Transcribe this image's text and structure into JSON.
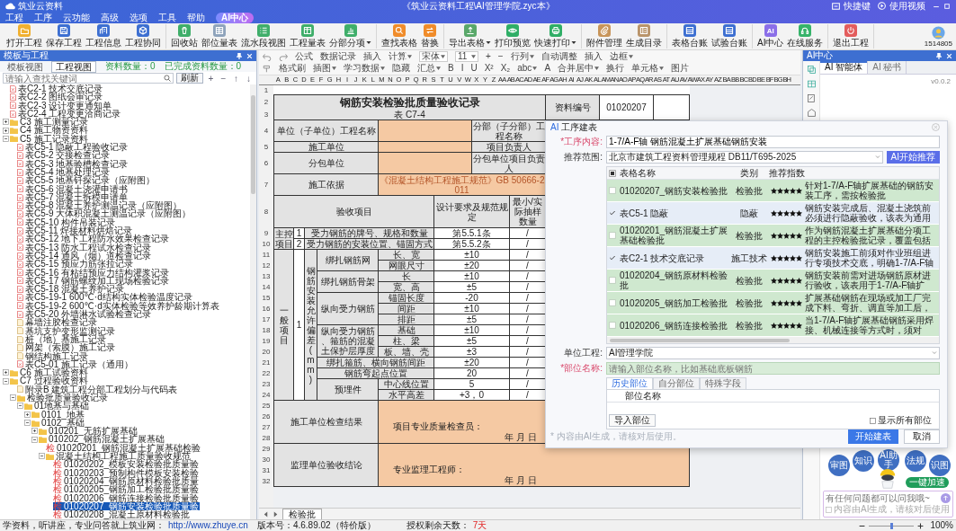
{
  "window": {
    "app_name": "筑业云资料",
    "title": "《筑业云资料工程\\AI管理学院.zyc本》",
    "links": [
      "快捷键",
      "使用视频"
    ]
  },
  "menu": [
    {
      "label": "工程",
      "kind": "item"
    },
    {
      "label": "工序",
      "kind": "item"
    },
    {
      "label": "云功能",
      "kind": "item"
    },
    {
      "label": "高级",
      "kind": "item"
    },
    {
      "label": "选项",
      "kind": "item"
    },
    {
      "label": "工具",
      "kind": "item"
    },
    {
      "label": "帮助",
      "kind": "item"
    },
    {
      "label": "AI中心",
      "kind": "pill"
    }
  ],
  "toolbar": {
    "groups": [
      [
        {
          "label": "打开工程",
          "has_menu": false
        },
        {
          "label": "保存工程",
          "has_menu": false
        },
        {
          "label": "工程信息",
          "has_menu": false
        },
        {
          "label": "工程协同",
          "has_menu": false
        }
      ],
      [
        {
          "label": "回收站",
          "has_menu": false
        },
        {
          "label": "部位量表",
          "has_menu": false
        },
        {
          "label": "流水段视图",
          "has_menu": false
        },
        {
          "label": "工程量表",
          "has_menu": false
        },
        {
          "label": "分部分项",
          "has_menu": true
        }
      ],
      [
        {
          "label": "查找表格",
          "has_menu": false
        },
        {
          "label": "替换",
          "has_menu": false
        }
      ],
      [
        {
          "label": "导出表格",
          "has_menu": true
        },
        {
          "label": "打印预览",
          "has_menu": false
        },
        {
          "label": "快速打印",
          "has_menu": true
        }
      ],
      [
        {
          "label": "附件管理",
          "has_menu": false
        },
        {
          "label": "生成目录",
          "has_menu": false
        }
      ],
      [
        {
          "label": "表格台账",
          "has_menu": false
        },
        {
          "label": "试验台账",
          "has_menu": false
        }
      ],
      [
        {
          "label": "AI中心",
          "glyph": "AI",
          "has_menu": false
        },
        {
          "label": "在线服务",
          "has_menu": false
        }
      ],
      [
        {
          "label": "退出工程",
          "has_menu": false
        }
      ]
    ],
    "user": "1514805"
  },
  "tree_panel": {
    "title": "模板与工程",
    "tabs": [
      {
        "label": "模板视图",
        "selected": false
      },
      {
        "label": "工程视图",
        "selected": true
      }
    ],
    "count": "资料数量：0",
    "done_count": "已完成资料数量：0",
    "search": {
      "placeholder": "请输入查找关键词"
    },
    "search_button": "刷新",
    "actions": [
      "+",
      "−",
      "↑",
      "↓"
    ]
  },
  "tree": {
    "items": [
      {
        "label": "表C2-1 技术交底记录",
        "kind": "form",
        "selected": false
      },
      {
        "label": "表C2-2 图纸会审记录",
        "kind": "form",
        "selected": false
      },
      {
        "label": "表C2-3 设计变更通知单",
        "kind": "form",
        "selected": false
      },
      {
        "label": "表C2-4 工程变更洽商记录",
        "kind": "form",
        "selected": false
      },
      {
        "label": "C3 施工测量记录",
        "kind": "folder",
        "expanded": false,
        "selected": false
      },
      {
        "label": "C4 施工物资资料",
        "kind": "folder",
        "expanded": false,
        "selected": false
      },
      {
        "label": "C5 施工记录资料",
        "kind": "folder",
        "expanded": true,
        "selected": false,
        "children": [
          {
            "label": "表C5-1 隐蔽工程验收记录",
            "kind": "form",
            "selected": false
          },
          {
            "label": "表C5-2 交接检查记录",
            "kind": "form",
            "selected": false
          },
          {
            "label": "表C5-3 地基验槽检查记录",
            "kind": "form",
            "selected": false
          },
          {
            "label": "表C5-4 地基处理记录",
            "kind": "form",
            "selected": false
          },
          {
            "label": "表C5-5 地基钎探记录（应附图）",
            "kind": "form",
            "selected": false
          },
          {
            "label": "表C5-6 混凝土浇灌申请书",
            "kind": "form",
            "selected": false
          },
          {
            "label": "表C5-7 混凝土拆模申请单",
            "kind": "form",
            "selected": false
          },
          {
            "label": "表C5-8 混凝土养护测温记录（应附图）",
            "kind": "form",
            "selected": false
          },
          {
            "label": "表C5-9 大体积混凝土测温记录（应附图）",
            "kind": "form",
            "selected": false
          },
          {
            "label": "表C5-10 构件吊装记录",
            "kind": "form",
            "selected": false
          },
          {
            "label": "表C5-11 焊接材料烘焙记录",
            "kind": "form",
            "selected": false
          },
          {
            "label": "表C5-12 地下工程防水效果检查记录",
            "kind": "form",
            "selected": false
          },
          {
            "label": "表C5-13 防水工程试水检查记录",
            "kind": "form",
            "selected": false
          },
          {
            "label": "表C5-14 通风（烟）道检查记录",
            "kind": "form",
            "selected": false
          },
          {
            "label": "表C5-15 预应力筋张拉记录",
            "kind": "form",
            "selected": false
          },
          {
            "label": "表C5-16 有粘结预应力结构灌浆记录",
            "kind": "form",
            "selected": false
          },
          {
            "label": "表C5-17 钢筋螺纹加工现场检验记录",
            "kind": "form",
            "selected": false
          },
          {
            "label": "表C5-18 混凝土养护记录",
            "kind": "form",
            "selected": false
          },
          {
            "label": "表C5-19-1 600℃·d结构实体检验温度记录",
            "kind": "form",
            "selected": false
          },
          {
            "label": "表C5-19-2 600℃·d实体检验等效养护龄期计算表",
            "kind": "form",
            "selected": false
          },
          {
            "label": "表C5-20 外墙淋水试验检查记录",
            "kind": "form",
            "selected": false
          },
          {
            "label": "幕墙注胶检查记录",
            "kind": "record",
            "selected": false
          },
          {
            "label": "基坑支护变形监测记录",
            "kind": "record",
            "selected": false
          },
          {
            "label": "桩（地）基施工记录",
            "kind": "record",
            "selected": false
          },
          {
            "label": "网架（索膜）施工记录",
            "kind": "record",
            "selected": false
          },
          {
            "label": "钢结构施工记录",
            "kind": "record",
            "selected": false
          },
          {
            "label": "表C5-01 施工记录（通用）",
            "kind": "form",
            "selected": false
          }
        ]
      },
      {
        "label": "C6 施工试验资料",
        "kind": "folder",
        "expanded": false,
        "selected": false
      },
      {
        "label": "C7 过程验收资料",
        "kind": "folder",
        "expanded": true,
        "selected": false,
        "children": [
          {
            "label": "附录B 建筑工程分部工程划分与代码表",
            "kind": "record",
            "selected": false
          },
          {
            "label": "检验批质量验收记录",
            "kind": "folder",
            "expanded": true,
            "selected": false,
            "children": [
              {
                "label": "01地基与基础",
                "kind": "folder",
                "expanded": true,
                "selected": false,
                "children": [
                  {
                    "label": "0101_地基",
                    "kind": "folder",
                    "expanded": false,
                    "selected": false
                  },
                  {
                    "label": "0102_基础",
                    "kind": "folder",
                    "expanded": true,
                    "selected": false,
                    "children": [
                      {
                        "label": "010201_无筋扩展基础",
                        "kind": "folder",
                        "expanded": false,
                        "selected": false
                      },
                      {
                        "label": "010202_钢筋混凝土扩展基础",
                        "kind": "folder",
                        "expanded": true,
                        "selected": false,
                        "children": [
                          {
                            "label": "01020201_钢筋混凝土扩展基础检验",
                            "kind": "batch",
                            "mark": "检",
                            "selected": false
                          },
                          {
                            "label": "混凝土结构工程施工质量验收规范",
                            "kind": "folder",
                            "expanded": true,
                            "selected": false,
                            "children": [
                              {
                                "label": "01020202_模板安装检验批质量验",
                                "kind": "batch",
                                "mark": "检",
                                "selected": false
                              },
                              {
                                "label": "01020203_预制构件模板安装检验",
                                "kind": "batch",
                                "mark": "检",
                                "selected": false
                              },
                              {
                                "label": "01020204_钢筋原材料检验批质量",
                                "kind": "batch",
                                "mark": "检",
                                "selected": false
                              },
                              {
                                "label": "01020205_钢筋加工检验批质量验",
                                "kind": "batch",
                                "mark": "检",
                                "selected": false
                              },
                              {
                                "label": "01020206_钢筋连接检验批质量验",
                                "kind": "batch",
                                "mark": "检",
                                "selected": false
                              },
                              {
                                "label": "01020207_钢筋安装检验批质量验",
                                "kind": "batch",
                                "mark": "检",
                                "selected": true
                              },
                              {
                                "label": "01020208_混凝土原材料检验批",
                                "kind": "batch",
                                "mark": "检",
                                "selected": false
                              }
                            ]
                          }
                        ]
                      }
                    ]
                  }
                ]
              }
            ]
          }
        ]
      }
    ]
  },
  "format_bar": {
    "top_row": [
      {
        "label": "公式",
        "kind": "button"
      },
      {
        "label": "数据记录",
        "kind": "button"
      },
      {
        "label": "插入",
        "kind": "button"
      },
      {
        "label": "计算",
        "kind": "menu"
      },
      {
        "label": "宋体",
        "kind": "select"
      },
      {
        "label": "11",
        "kind": "select"
      },
      {
        "label": "+",
        "kind": "button"
      },
      {
        "label": "−",
        "kind": "button"
      },
      {
        "label": "行列",
        "kind": "menu"
      },
      {
        "label": "自动调整",
        "kind": "button"
      },
      {
        "label": "插入",
        "kind": "button"
      },
      {
        "label": "边框",
        "kind": "menu"
      }
    ],
    "bottom_row": [
      {
        "label": "格式刷",
        "kind": "button"
      },
      {
        "label": "插图",
        "kind": "menu"
      },
      {
        "label": "学习数据",
        "kind": "menu"
      },
      {
        "label": "隐藏",
        "kind": "button"
      },
      {
        "label": "汇总",
        "kind": "menu"
      },
      {
        "label": "B",
        "kind": "button"
      },
      {
        "label": "I",
        "kind": "button"
      },
      {
        "label": "U",
        "kind": "button"
      },
      {
        "label": "X²",
        "kind": "button"
      },
      {
        "label": "X₂",
        "kind": "button"
      },
      {
        "label": "abc",
        "kind": "menu"
      },
      {
        "label": "A",
        "kind": "button"
      },
      {
        "label": "合并居中",
        "kind": "menu"
      },
      {
        "label": "换行",
        "kind": "button"
      },
      {
        "label": "单元格",
        "kind": "menu"
      },
      {
        "label": "图片",
        "kind": "button"
      }
    ]
  },
  "form": {
    "column_letters": [
      "A",
      "B",
      "C",
      "D",
      "E",
      "F",
      "G",
      "H",
      "I",
      "J",
      "K",
      "L",
      "M",
      "N",
      "O",
      "P",
      "Q",
      "R",
      "S",
      "T",
      "U",
      "V",
      "W",
      "X",
      "Y",
      "Z",
      "AA",
      "AB",
      "AC",
      "AD",
      "AE",
      "AF",
      "AG",
      "AH",
      "AI",
      "AJ",
      "AK",
      "AL",
      "AM",
      "AN",
      "AO",
      "AP",
      "AQ",
      "AR",
      "AS",
      "AT",
      "AU",
      "AV",
      "AW",
      "AX",
      "AY",
      "AZ",
      "BA",
      "BB",
      "BC",
      "BD",
      "BE",
      "BF",
      "BG",
      "BH"
    ],
    "row_numbers": [
      "1",
      "2",
      "3",
      "4",
      "5",
      "6",
      "7",
      "8",
      "9",
      "10",
      "11",
      "12",
      "13",
      "14",
      "15",
      "16",
      "17",
      "18",
      "19",
      "20",
      "21",
      "22",
      "23",
      "24",
      "25",
      "26",
      "27",
      "28",
      "29",
      "30",
      "31",
      "32"
    ],
    "cells": [
      "钢筋安装检验批质量验收记录",
      "表 C7-4",
      "资料编号",
      "01020207",
      "单位（子单位）工程名称",
      "分部（子分部）工程名称",
      "施工单位",
      "项目负责人",
      "分包单位",
      "分包单位项目负责人",
      "施工依据",
      "《混凝土结构工程施工规范》GB 50666-2011",
      "验收项目",
      "设计要求及规范规定",
      "最小/实际抽样数量",
      "主控项目",
      "1",
      "受力钢筋的牌号、规格和数量",
      "第5.5.1条",
      "/",
      "2",
      "受力钢筋的安装位置、锚固方式",
      "第5.5.2条",
      "/",
      "一般项目",
      "1",
      "钢筋安装允许偏差(mm)",
      "绑扎钢筋网",
      "长、宽",
      "±10",
      "/",
      "网眼尺寸",
      "±20",
      "/",
      "绑扎钢筋骨架",
      "长",
      "±10",
      "/",
      "宽、高",
      "±5",
      "/",
      "纵向受力钢筋",
      "锚固长度",
      "-20",
      "/",
      "间距",
      "±10",
      "/",
      "排距",
      "±5",
      "/",
      "纵向受力钢筋、箍筋的混凝土保护层厚度",
      "基础",
      "±10",
      "/",
      "柱、梁",
      "±5",
      "/",
      "板、墙、壳",
      "±3",
      "/",
      "绑扎箍筋、横向钢筋间距",
      "±20",
      "/",
      "钢筋弯起点位置",
      "20",
      "/",
      "预埋件",
      "中心线位置",
      "5",
      "/",
      "水平高差",
      "+3，0",
      "/",
      "施工单位检查结果",
      "项目专业质量检查员：",
      "年 月 日",
      "监理单位验收结论",
      "专业监理工程师：",
      "年 月 日"
    ]
  },
  "sheet_tabs": [
    {
      "label": "检验批",
      "selected": true
    }
  ],
  "dialog": {
    "badge": "AI",
    "title": "工序建表",
    "fields": {
      "process": {
        "label": "*工序内容:",
        "required": true,
        "value": "1-7/A-F轴 钢筋混凝土扩展基础钢筋安装"
      },
      "scope": {
        "label": "推荐范围:",
        "required": false,
        "value": "北京市建筑工程资料管理规程 DB11/T695-2025"
      }
    },
    "recommend_button": "AI开始推荐",
    "table": {
      "select_all": {
        "checked": false,
        "indeterminate": true
      },
      "columns": [
        "表格名称",
        "类别",
        "推荐指数"
      ],
      "rows": [
        {
          "checked": false,
          "name": "01020207_钢筋安装检验批",
          "type": "检验批",
          "stars": 5,
          "reason": "针对1-7/A-F轴扩展基础的钢筋安装工序，需按检验批"
        },
        {
          "checked": true,
          "name": "表C5-1 隐蔽",
          "type": "隐蔽",
          "stars": 5,
          "reason": "钢筋安装完成后、混凝土浇筑前必须进行隐蔽验收，该表为通用"
        },
        {
          "checked": false,
          "name": "01020201_钢筋混凝土扩展基础检验批",
          "type": "检验批",
          "stars": 5,
          "reason": "作为钢筋混凝土扩展基础分项工程的主控检验批记录，覆盖包括"
        },
        {
          "checked": true,
          "name": "表C2-1 技术交底记录",
          "type": "施工技术",
          "stars": 5,
          "reason": "钢筋安装施工前须对作业班组进行专项技术交底，明确1-7/A-F轴"
        },
        {
          "checked": false,
          "name": "01020204_钢筋原材料检验批",
          "type": "检验批",
          "stars": 5,
          "reason": "钢筋安装前需对进场钢筋原材进行验收，该表用于1-7/A-F轴扩"
        },
        {
          "checked": false,
          "name": "01020205_钢筋加工检验批",
          "type": "检验批",
          "stars": 5,
          "reason": "扩展基础钢筋在现场或加工厂完成下料、弯折、调直等加工后，"
        },
        {
          "checked": false,
          "name": "01020206_钢筋连接检验批",
          "type": "检验批",
          "stars": 5,
          "reason": "当1-7/A-F轴扩展基础钢筋采用焊接、机械连接等方式时，须对"
        }
      ]
    },
    "unit": {
      "label": "单位工程:",
      "required": false,
      "value": "AI管理学院"
    },
    "part": {
      "label": "*部位名称:",
      "required": true,
      "placeholder": "请输入部位名称，比如基础底板钢筋"
    },
    "part_tabs": [
      {
        "label": "历史部位",
        "selected": true
      },
      {
        "label": "自分部位",
        "selected": false
      },
      {
        "label": "特殊字段",
        "selected": false
      }
    ],
    "part_column": "部位名称",
    "import_button": "导入部位",
    "show_all": {
      "label": "显示所有部位",
      "checked": false
    },
    "note": "* 内容由AI生成，请核对后使用。",
    "ok_button": "开始建表",
    "cancel_button": "取消"
  },
  "ai_panel": {
    "title": "AI中心",
    "tabs": [
      {
        "label": "AI 智能体",
        "selected": true
      },
      {
        "label": "AI 秘书",
        "selected": false
      }
    ],
    "version": "v0.0.2",
    "bubbles": [
      "审图",
      "知识",
      "AI助手",
      "法规",
      "识图"
    ],
    "boost_button": "一键加速",
    "chat": {
      "placeholder": "有任何问题都可以问我哦~"
    },
    "agree": {
      "label": "内容由AI生成，请核对后使用",
      "checked": false
    }
  },
  "status_bar": {
    "text": "学资料，听讲座，专业问答就上筑业网：",
    "link": "http://www.zhuye.cn",
    "version": "版本号：4.6.89.02（特价版）",
    "license_label": "授权剩余天数：",
    "license_days": "7天",
    "zoom_slider": {
      "level": 0.5
    },
    "zoom": "100%"
  }
}
